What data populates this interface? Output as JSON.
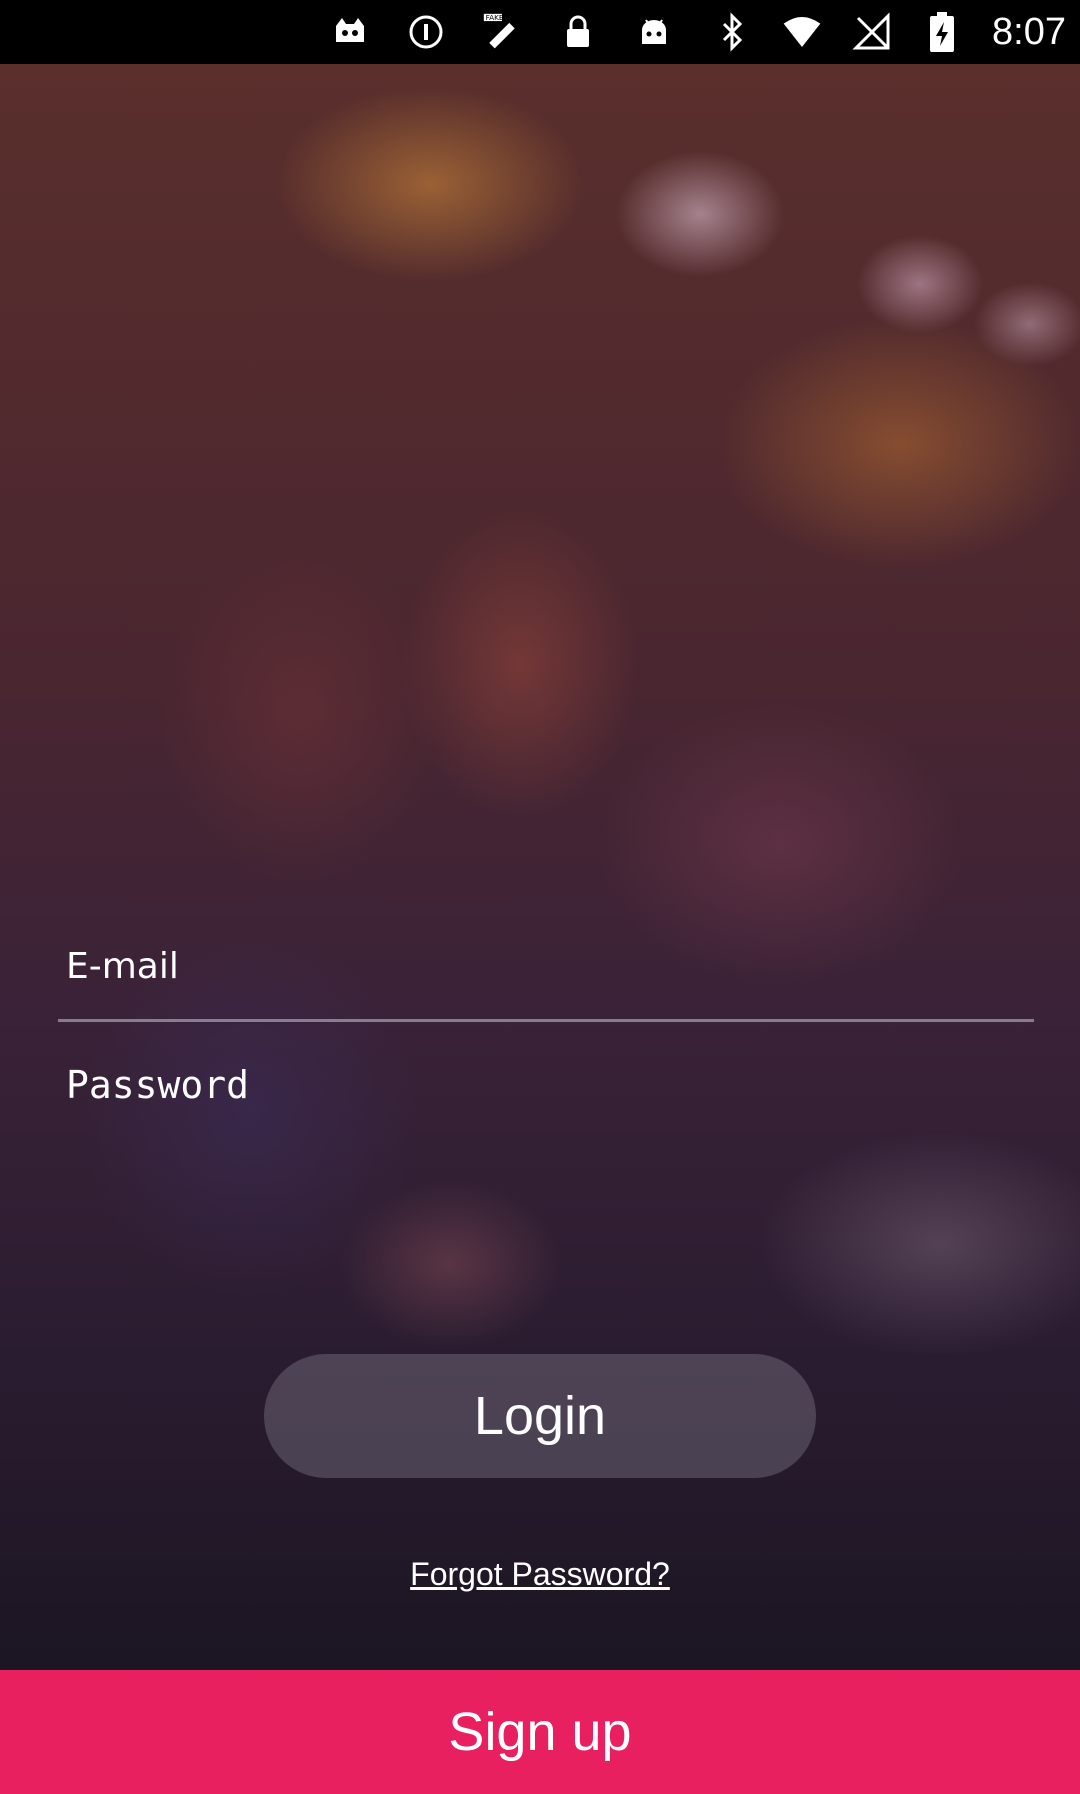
{
  "status_bar": {
    "time": "8:07",
    "left_icons": [
      "android-icon",
      "info-icon",
      "fake-gps-icon",
      "lock-icon",
      "android-robot-icon"
    ],
    "right_icons": [
      "bluetooth-icon",
      "wifi-icon",
      "signal-icon",
      "battery-charging-icon"
    ]
  },
  "form": {
    "email_placeholder": "E-mail",
    "password_placeholder": "Password"
  },
  "buttons": {
    "login_label": "Login",
    "forgot_label": "Forgot Password?",
    "signup_label": "Sign up"
  },
  "colors": {
    "signup": "#e8205f",
    "statusbar": "#000000"
  }
}
